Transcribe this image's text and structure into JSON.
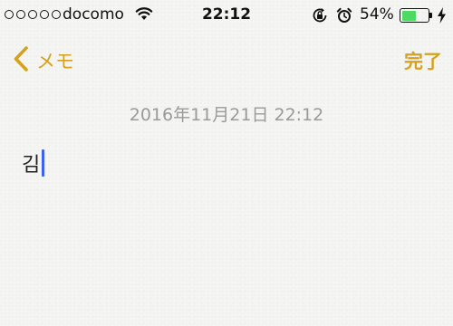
{
  "status_bar": {
    "signal_dots": 5,
    "carrier": "docomo",
    "time": "22:12",
    "battery_percent": "54%",
    "battery_level": 0.54,
    "battery_color": "#4cd964"
  },
  "nav": {
    "back_label": "メモ",
    "done_label": "完了",
    "accent_color": "#d4a21e"
  },
  "note": {
    "date": "2016年11月21日 22:12",
    "text": "김"
  },
  "icons": [
    "wifi-icon",
    "rotation-lock-icon",
    "alarm-icon",
    "battery-icon",
    "charging-bolt-icon",
    "chevron-left-icon"
  ]
}
